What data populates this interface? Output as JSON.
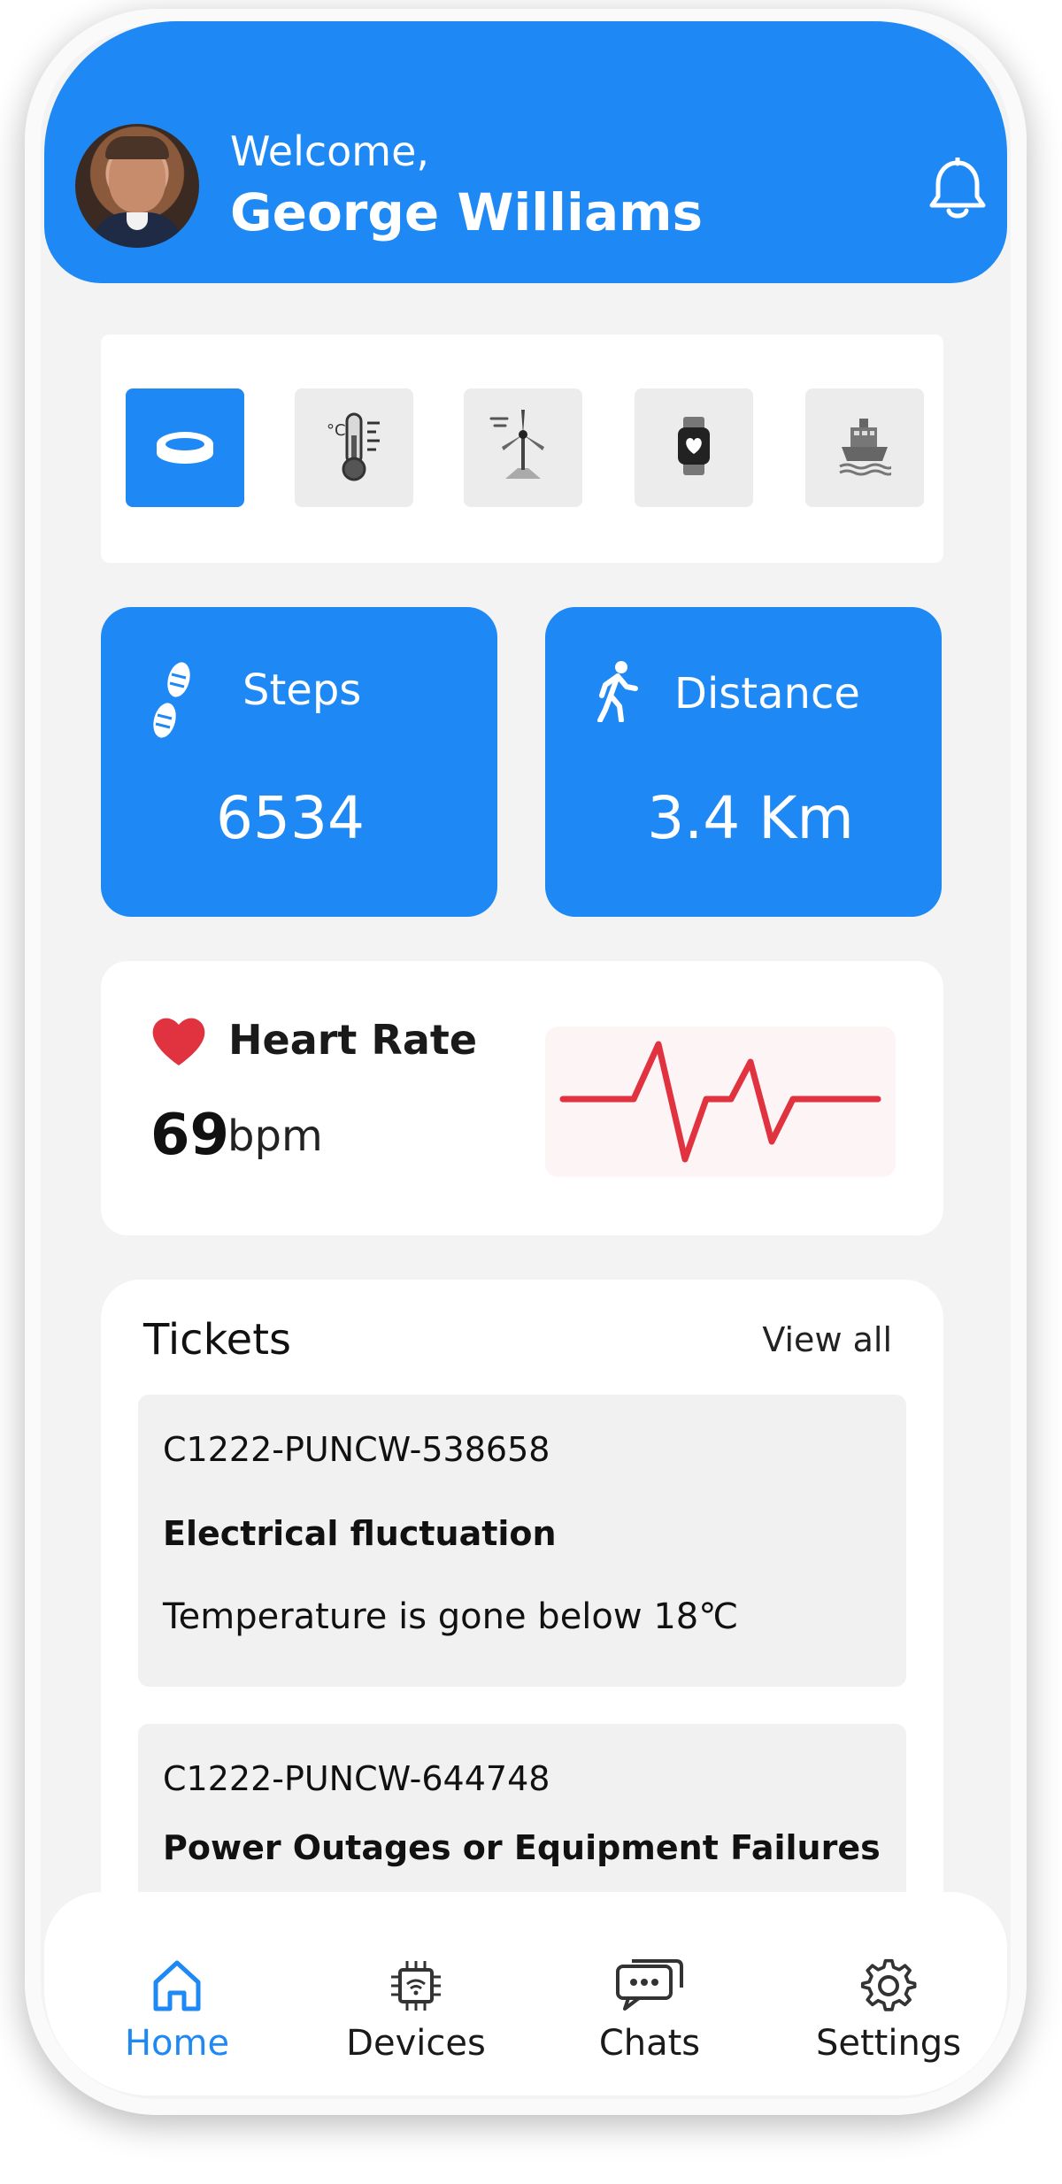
{
  "header": {
    "welcome": "Welcome,",
    "user_name": "George Williams"
  },
  "device_tabs": [
    {
      "name": "ring",
      "icon": "ring-icon",
      "active": true
    },
    {
      "name": "thermometer",
      "icon": "thermometer-icon",
      "active": false
    },
    {
      "name": "wind-turbine",
      "icon": "wind-turbine-icon",
      "active": false
    },
    {
      "name": "smartwatch",
      "icon": "smartwatch-icon",
      "active": false
    },
    {
      "name": "ship",
      "icon": "ship-icon",
      "active": false
    }
  ],
  "stats": {
    "steps": {
      "label": "Steps",
      "value": "6534",
      "icon": "footprints-icon"
    },
    "distance": {
      "label": "Distance",
      "value": "3.4 Km",
      "icon": "walking-person-icon"
    }
  },
  "heart_rate": {
    "title": "Heart Rate",
    "value": "69",
    "unit": "bpm",
    "icon": "heart-icon",
    "color": "#e0323f"
  },
  "tickets": {
    "title": "Tickets",
    "view_all": "View all",
    "items": [
      {
        "id": "C1222-PUNCW-538658",
        "subject": "Electrical fluctuation",
        "description": "Temperature is gone below 18℃"
      },
      {
        "id": "C1222-PUNCW-644748",
        "subject": "Power Outages or Equipment Failures",
        "description": ""
      }
    ]
  },
  "bottom_nav": [
    {
      "label": "Home",
      "icon": "home-icon",
      "active": true
    },
    {
      "label": "Devices",
      "icon": "chip-icon",
      "active": false
    },
    {
      "label": "Chats",
      "icon": "chat-bubbles-icon",
      "active": false
    },
    {
      "label": "Settings",
      "icon": "gear-icon",
      "active": false
    }
  ],
  "colors": {
    "accent": "#1e88f5",
    "background": "#f3f3f4",
    "heart": "#e0323f"
  }
}
